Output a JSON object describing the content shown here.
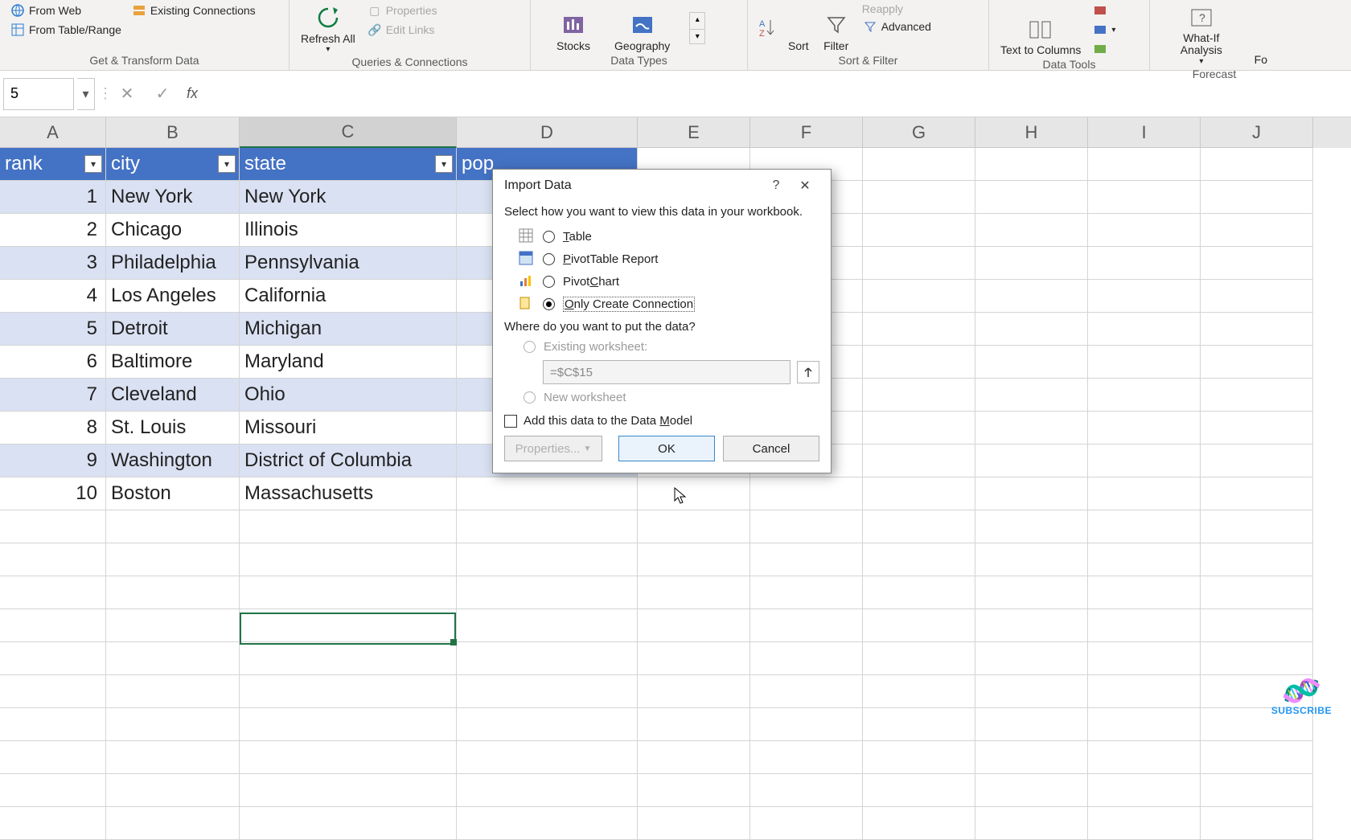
{
  "ribbon": {
    "gettransform": {
      "from_web": "From Web",
      "from_table": "From Table/Range",
      "existing_conn": "Existing Connections",
      "label": "Get & Transform Data"
    },
    "queries": {
      "refresh": "Refresh All",
      "properties": "Properties",
      "edit_links": "Edit Links",
      "label": "Queries & Connections"
    },
    "datatypes": {
      "stocks": "Stocks",
      "geography": "Geography",
      "label": "Data Types"
    },
    "sortfilter": {
      "sort": "Sort",
      "filter": "Filter",
      "reapply": "Reapply",
      "advanced": "Advanced",
      "label": "Sort & Filter"
    },
    "datatools": {
      "text_to_columns": "Text to Columns",
      "label": "Data Tools"
    },
    "forecast": {
      "whatif": "What-If Analysis",
      "forecast_sheet": "Fo",
      "label": "Forecast"
    }
  },
  "namebox": "5",
  "fx": "fx",
  "columns": [
    "A",
    "B",
    "C",
    "D",
    "E",
    "F",
    "G",
    "H",
    "I",
    "J"
  ],
  "table": {
    "headers": [
      "rank",
      "city",
      "state",
      "pop"
    ],
    "rows": [
      {
        "rank": "1",
        "city": "New York",
        "state": "New York"
      },
      {
        "rank": "2",
        "city": "Chicago",
        "state": "Illinois"
      },
      {
        "rank": "3",
        "city": "Philadelphia",
        "state": "Pennsylvania"
      },
      {
        "rank": "4",
        "city": "Los Angeles",
        "state": "California"
      },
      {
        "rank": "5",
        "city": "Detroit",
        "state": "Michigan"
      },
      {
        "rank": "6",
        "city": "Baltimore",
        "state": "Maryland"
      },
      {
        "rank": "7",
        "city": "Cleveland",
        "state": "Ohio"
      },
      {
        "rank": "8",
        "city": "St. Louis",
        "state": "Missouri"
      },
      {
        "rank": "9",
        "city": "Washington",
        "state": "District of Columbia"
      },
      {
        "rank": "10",
        "city": "Boston",
        "state": "Massachusetts"
      }
    ]
  },
  "dialog": {
    "title": "Import Data",
    "prompt": "Select how you want to view this data in your workbook.",
    "opt_table": "able",
    "opt_table_key": "T",
    "opt_pivot": "ivotTable Report",
    "opt_pivot_key": "P",
    "opt_pivotchart": "Pivot",
    "opt_pivotchart_key": "C",
    "opt_pivotchart_rest": "hart",
    "opt_conn_key": "O",
    "opt_conn": "nly Create Connection",
    "where": "Where do you want to put the data?",
    "existing_ws": "Existing worksheet:",
    "cell_ref": "=$C$15",
    "new_ws": "New worksheet",
    "add_model_pre": "Add this data to the Data ",
    "add_model_key": "M",
    "add_model_post": "odel",
    "properties": "Properties...",
    "ok": "OK",
    "cancel": "Cancel"
  },
  "subscribe": "SUBSCRIBE"
}
